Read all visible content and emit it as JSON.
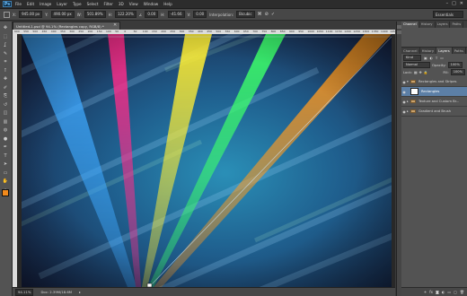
{
  "app": {
    "logo": "Ps"
  },
  "menus": [
    "File",
    "Edit",
    "Image",
    "Layer",
    "Type",
    "Select",
    "Filter",
    "3D",
    "View",
    "Window",
    "Help"
  ],
  "window_controls": [
    "–",
    "□",
    "✕"
  ],
  "options_bar": {
    "x_label": "X:",
    "x_value": "945.00 px",
    "y_label": "Y:",
    "y_value": "490.00 px",
    "w_label": "W:",
    "w_value": "501.89%",
    "h_label": "H:",
    "h_value": "122.20%",
    "angle_value": "0.00",
    "h_skew_label": "H:",
    "h_skew_value": "-41.66",
    "v_skew_label": "V:",
    "v_skew_value": "0.00",
    "interpolation_label": "Interpolation:",
    "interpolation_value": "Bicubic"
  },
  "workspace": {
    "value": "Essentials"
  },
  "tools": [
    "move-tool",
    "marquee-tool",
    "lasso-tool",
    "quick-select-tool",
    "crop-tool",
    "eyedropper-tool",
    "healing-tool",
    "brush-tool",
    "clone-stamp-tool",
    "history-brush-tool",
    "eraser-tool",
    "gradient-tool",
    "blur-tool",
    "dodge-tool",
    "pen-tool",
    "type-tool",
    "path-select-tool",
    "shape-tool",
    "hand-tool",
    "zoom-tool"
  ],
  "tool_glyphs": [
    "✥",
    "⬚",
    "ʆ",
    "✎",
    "⌗",
    "ꝉ",
    "✚",
    "✐",
    "⎘",
    "↺",
    "◫",
    "▥",
    "◍",
    "●",
    "✒",
    "T",
    "➤",
    "▭",
    "✋",
    "⌕"
  ],
  "colors": {
    "foreground": "#f28a1c",
    "background": "#f2f2f2"
  },
  "document": {
    "tab_title": "Untitled-1.psd @ 94.1% (Rectangles copy, RGB/8) *",
    "close": "✕",
    "ruler_ticks": [
      "600",
      "550",
      "500",
      "450",
      "400",
      "350",
      "300",
      "250",
      "200",
      "150",
      "100",
      "50",
      "0",
      "50",
      "100",
      "150",
      "200",
      "250",
      "300",
      "350",
      "400",
      "450",
      "500",
      "550",
      "600",
      "650",
      "700",
      "750",
      "800",
      "850",
      "900",
      "950",
      "1000",
      "1050",
      "1100",
      "1150",
      "1200",
      "1250",
      "1300",
      "1350",
      "1400",
      "1450"
    ],
    "rays": [
      {
        "name": "blue-ray",
        "color": "#3fa9ff"
      },
      {
        "name": "magenta-ray",
        "color": "#ff2d8a"
      },
      {
        "name": "yellow-ray",
        "color": "#ffee33"
      },
      {
        "name": "green-ray",
        "color": "#3dff6a"
      },
      {
        "name": "orange-ray",
        "color": "#ff9a1f"
      }
    ]
  },
  "status": {
    "zoom": "94.11%",
    "doc_size": "Doc: 2.39M/18.6M"
  },
  "upper_panel_tabs": [
    "Channel",
    "History",
    "Layers",
    "Paths"
  ],
  "layers_panel": {
    "tabs": [
      "Channel",
      "History",
      "Layers",
      "Paths"
    ],
    "kind_value": "Kind",
    "blend_mode": "Normal",
    "opacity_label": "Opacity:",
    "opacity_value": "100%",
    "lock_label": "Lock:",
    "fill_label": "Fill:",
    "fill_value": "100%",
    "layers": [
      {
        "name": "Rectangles and Stripes",
        "type": "group",
        "expanded": true
      },
      {
        "name": "Rectangles",
        "type": "layer",
        "selected": true
      },
      {
        "name": "Texture and Custom Br...",
        "type": "group",
        "expanded": false
      },
      {
        "name": "Gradient and Brush",
        "type": "group",
        "expanded": false
      }
    ],
    "bottom_icons": [
      "link-icon",
      "fx-icon",
      "mask-icon",
      "adjustment-icon",
      "new-group-icon",
      "new-layer-icon",
      "trash-icon"
    ],
    "bottom_glyphs": [
      "⚭",
      "fx",
      "◙",
      "◐",
      "▭",
      "▢",
      "🗑"
    ]
  }
}
